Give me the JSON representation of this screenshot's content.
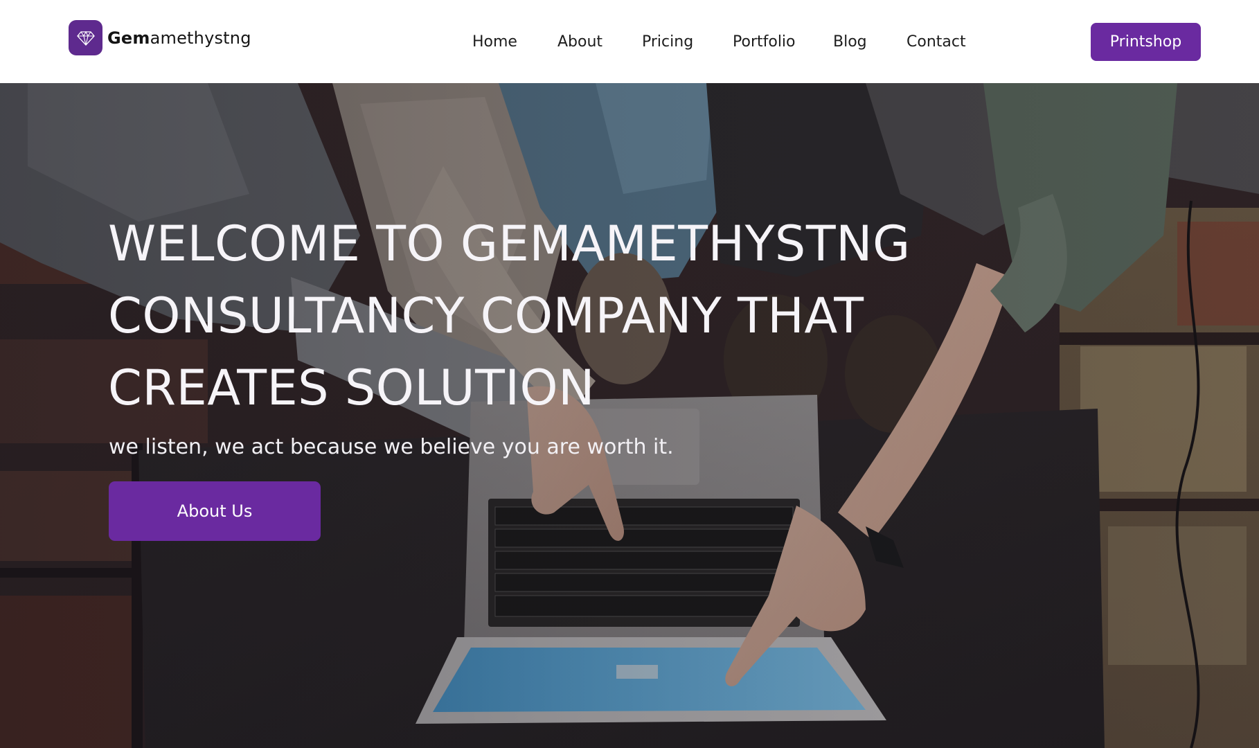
{
  "brand": {
    "name_bold": "Gem",
    "name_rest": "amethystng",
    "logo_icon": "diamond-icon",
    "color": "#5e2a8e"
  },
  "nav": {
    "items": [
      {
        "label": "Home"
      },
      {
        "label": "About"
      },
      {
        "label": "Pricing"
      },
      {
        "label": "Portfolio"
      },
      {
        "label": "Blog"
      },
      {
        "label": "Contact"
      }
    ],
    "cta_label": "Printshop"
  },
  "hero": {
    "title_lines": [
      "WELCOME TO GEMAMETHYSTNG",
      "CONSULTANCY COMPANY THAT",
      "CREATES SOLUTION"
    ],
    "subtitle": "we listen, we act because we believe you are worth it.",
    "button_label": "About Us",
    "accent_color": "#6a2aa0"
  }
}
